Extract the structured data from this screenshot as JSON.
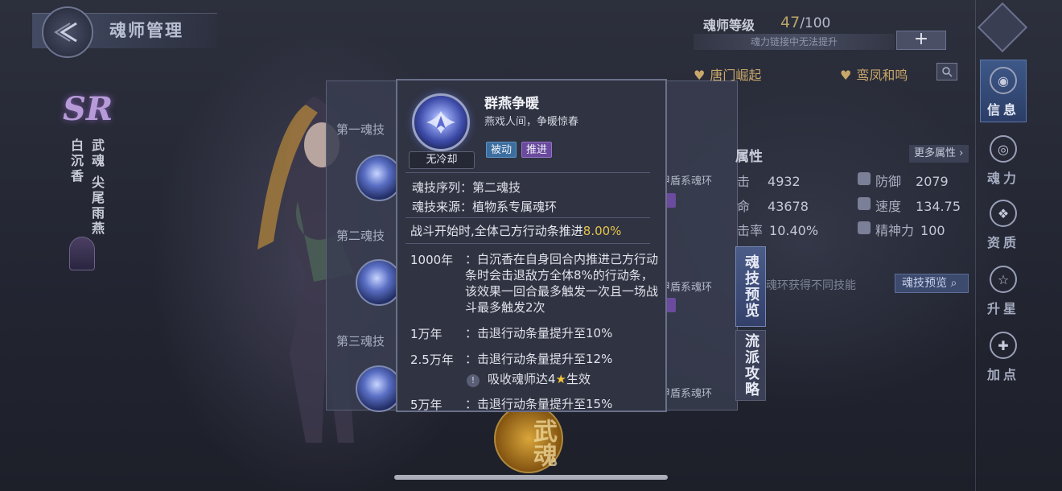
{
  "header": {
    "title": "魂师管理"
  },
  "character": {
    "rarity": "SR",
    "name": "白沉香",
    "wuhun_label": "武魂",
    "wuhun_name": "尖尾雨燕"
  },
  "skills_list": {
    "slots": [
      "第一魂技",
      "第二魂技",
      "第三魂技"
    ],
    "ring_type": "甲盾系魂环"
  },
  "side_tabs": {
    "skill_preview": "魂技预览",
    "strategy": "流派攻略"
  },
  "wuhun_orb": {
    "label": "武魂"
  },
  "level": {
    "label": "魂师等级",
    "current": "47",
    "max": "/100",
    "note": "魂力链接中无法提升",
    "plus": "+"
  },
  "bonds": [
    "唐门崛起",
    "鸾凤和鸣"
  ],
  "attributes": {
    "title": "属性",
    "more": "更多属性",
    "stats": [
      {
        "label": "击",
        "value": "4932"
      },
      {
        "label": "防御",
        "value": "2079"
      },
      {
        "label": "命",
        "value": "43678"
      },
      {
        "label": "速度",
        "value": "134.75"
      },
      {
        "label": "击率",
        "value": "10.40%"
      },
      {
        "label": "精神力",
        "value": "100"
      }
    ],
    "hint": "魂环获得不同技能",
    "preview_button": "魂技预览"
  },
  "nav": [
    {
      "label": "信息",
      "icon": "info-icon",
      "active": true
    },
    {
      "label": "魂力",
      "icon": "soul-power-icon",
      "active": false
    },
    {
      "label": "资质",
      "icon": "aptitude-icon",
      "active": false
    },
    {
      "label": "升星",
      "icon": "star-up-icon",
      "active": false
    },
    {
      "label": "加点",
      "icon": "add-point-icon",
      "active": false
    }
  ],
  "popup": {
    "cooldown": "无冷却",
    "name": "群燕争暖",
    "subtitle": "燕戏人间，争暖惊春",
    "tags": [
      "被动",
      "推进"
    ],
    "sequence": "魂技序列：第二魂技",
    "source": "魂技来源：植物系专属魂环",
    "initial_prefix": "战斗开始时,全体己方行动条推进",
    "initial_value": "8.00%",
    "tiers": [
      {
        "age": "1000年",
        "desc": "：白沉香在自身回合内推进己方行动条时会击退敌方全体8%的行动条，该效果一回合最多触发一次且一场战斗最多触发2次"
      },
      {
        "age": "1万年",
        "desc": "：击退行动条量提升至10%"
      },
      {
        "age": "2.5万年",
        "desc": "：击退行动条量提升至12%"
      },
      {
        "age": "5万年",
        "desc": "：击退行动条量提升至15%"
      }
    ],
    "requirement_prefix": "吸收魂师达4",
    "requirement_star": "★",
    "requirement_suffix": "生效"
  }
}
